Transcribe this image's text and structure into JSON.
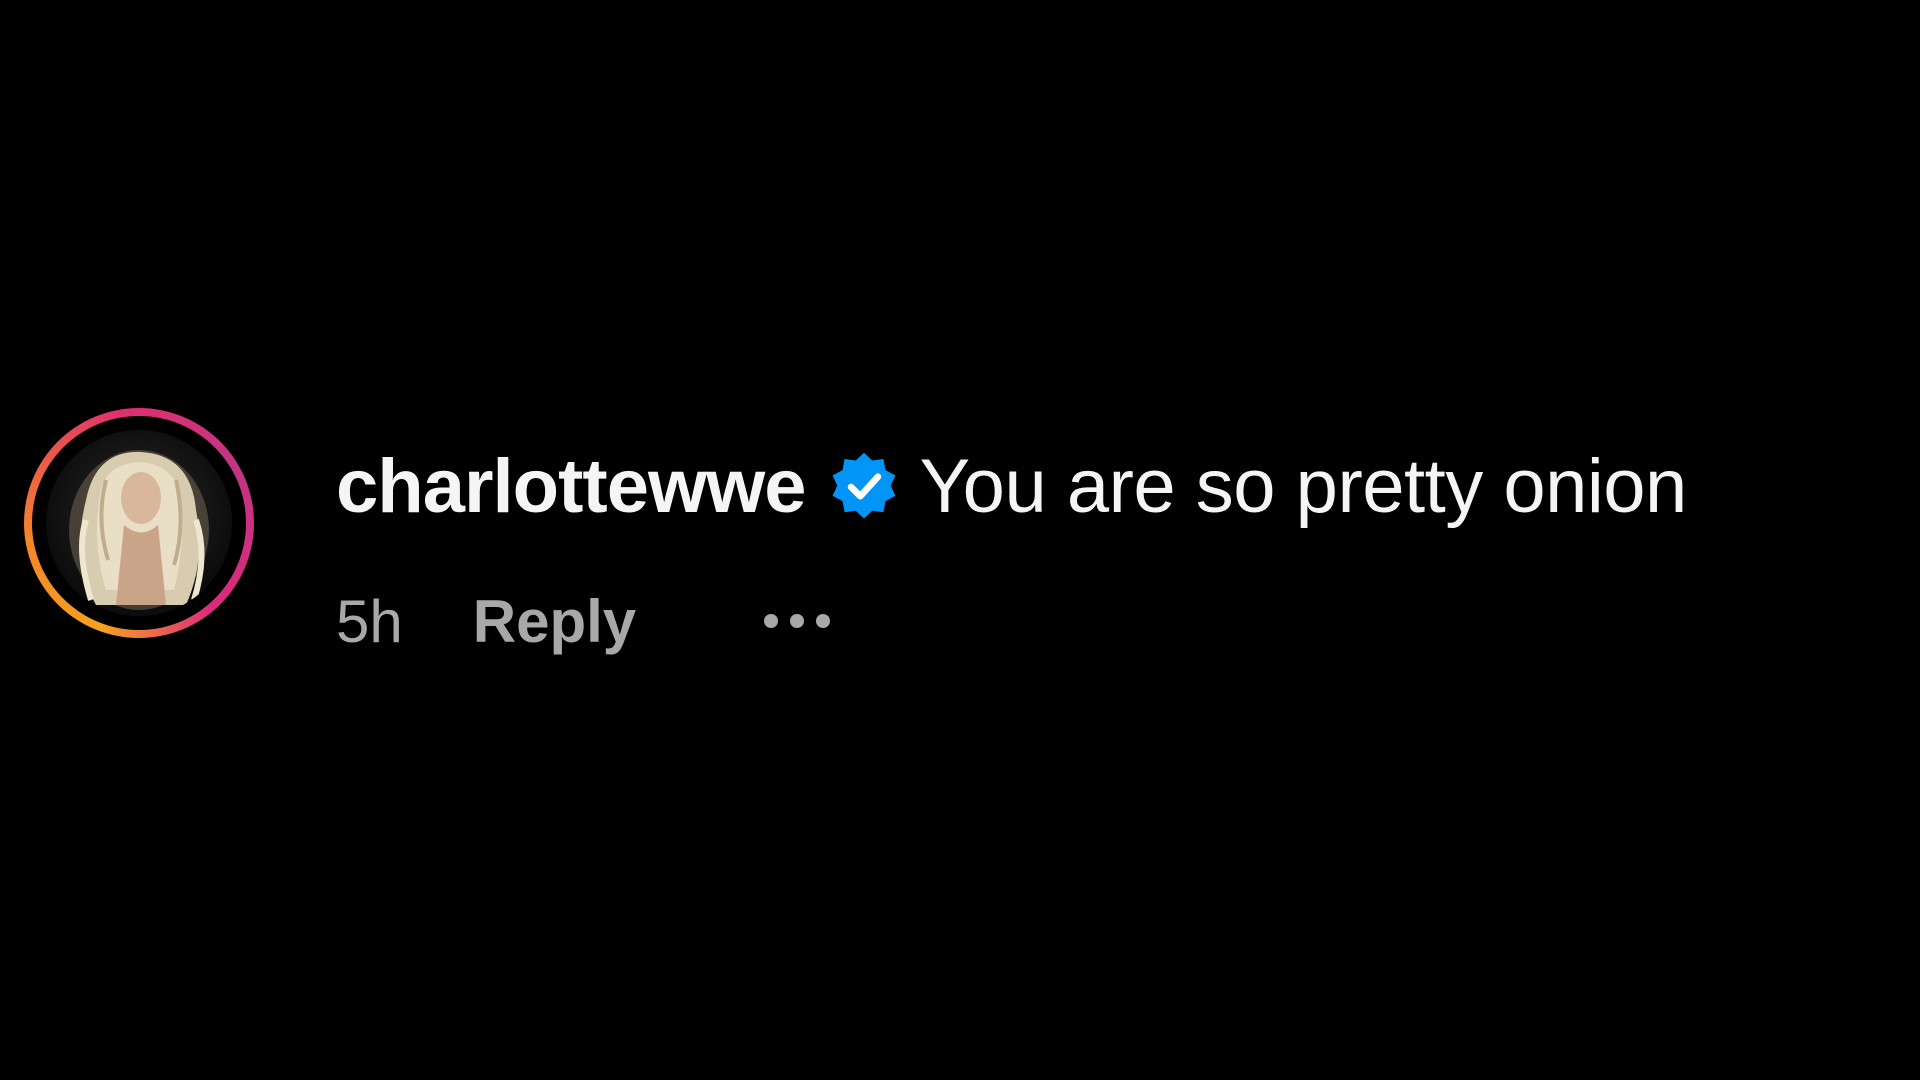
{
  "comment": {
    "username": "charlottewwe",
    "verified": true,
    "text": "You are so pretty onion",
    "timestamp": "5h",
    "reply_label": "Reply",
    "more_icon": "more-horizontal-icon",
    "avatar_icon": "profile-photo"
  },
  "colors": {
    "background": "#000000",
    "primary_text": "#f5f5f5",
    "secondary_text": "#a8a8a8",
    "verified_badge": "#0095f6",
    "story_ring_start": "#f58529",
    "story_ring_end": "#c13584"
  }
}
